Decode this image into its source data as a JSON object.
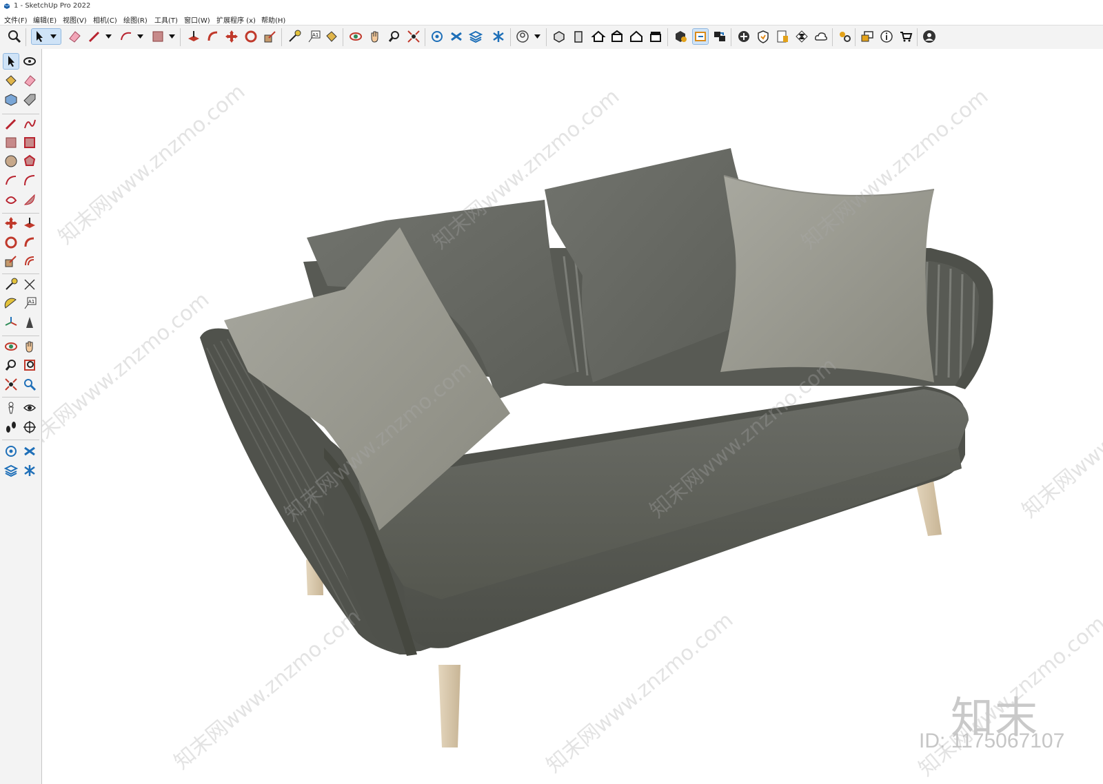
{
  "window": {
    "title": "1 - SketchUp Pro 2022"
  },
  "menu": [
    "文件(F)",
    "编辑(E)",
    "视图(V)",
    "相机(C)",
    "绘图(R)",
    "工具(T)",
    "窗口(W)",
    "扩展程序 (x)",
    "帮助(H)"
  ],
  "watermark": {
    "site": "知末网www.znzmo.com",
    "brand": "知末",
    "id": "ID: 1175067107"
  },
  "colors": {
    "toolbar_bg": "#f3f3f3",
    "active_tool": "#cfe3f7",
    "sofa_dark": "#5c5e59",
    "pillow_light": "#9a9a90",
    "leg_wood": "#d8c8ae"
  },
  "toolbar_icons": [
    "zoom-extents",
    "select",
    "eraser",
    "pencil-line",
    "arc",
    "rectangle",
    "push-pull",
    "follow-me",
    "move",
    "rotate",
    "scale",
    "tape-measure",
    "text",
    "paint-bucket",
    "orbit",
    "pan",
    "zoom",
    "zoom-window",
    "outliner",
    "tags",
    "components",
    "styles",
    "profile",
    "views-iso",
    "views-front",
    "views-home",
    "views-top",
    "views-house",
    "views-right",
    "warehouse",
    "section",
    "scenes",
    "add",
    "shield",
    "materials",
    "xray",
    "cloud",
    "settings",
    "dialog",
    "info",
    "cart",
    "account"
  ],
  "left_tools": [
    "select",
    "orbit",
    "paint",
    "eraser",
    "component",
    "tag",
    "line",
    "freehand",
    "rectangle",
    "rotated-rectangle",
    "circle",
    "polygon",
    "arc",
    "2point-arc",
    "3point-arc",
    "pie",
    "move",
    "push-pull",
    "rotate",
    "follow-me",
    "scale",
    "offset",
    "tape",
    "dimension",
    "protractor",
    "text",
    "axes",
    "3d-text",
    "orbit-2",
    "pan",
    "zoom",
    "zoom-window",
    "zoom-extents",
    "previous",
    "position-camera",
    "look-around",
    "walk",
    "section-plane",
    "outliner",
    "tags",
    "components",
    "styles"
  ]
}
